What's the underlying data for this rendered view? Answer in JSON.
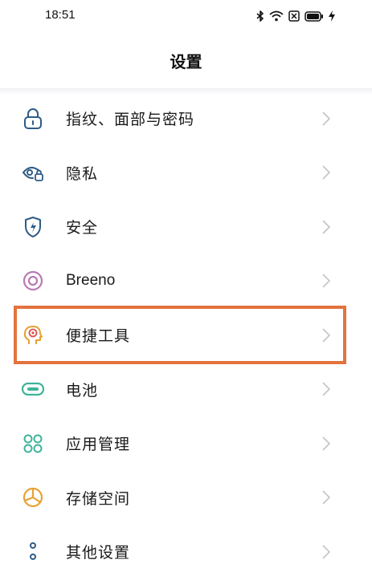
{
  "status": {
    "time": "18:51",
    "icons": [
      "bluetooth-icon",
      "wifi-icon",
      "sim-blocked-icon",
      "battery-icon",
      "charging-icon"
    ]
  },
  "header": {
    "title": "设置"
  },
  "colors": {
    "accent_highlight": "#e2733e",
    "icon_blue": "#2f5b86",
    "icon_purple": "#b87ab3",
    "icon_yellow": "#e6a234",
    "icon_green": "#3fb39b",
    "chevron": "#c4c4c4"
  },
  "settings": {
    "items": [
      {
        "label": "指纹、面部与密码",
        "icon": "lock-icon"
      },
      {
        "label": "隐私",
        "icon": "privacy-eye-lock-icon"
      },
      {
        "label": "安全",
        "icon": "shield-bolt-icon"
      },
      {
        "label": "Breeno",
        "icon": "breeno-ring-icon"
      },
      {
        "label": "便捷工具",
        "icon": "head-target-icon",
        "highlighted": true
      },
      {
        "label": "电池",
        "icon": "battery-capsule-icon"
      },
      {
        "label": "应用管理",
        "icon": "app-grid-icon"
      },
      {
        "label": "存储空间",
        "icon": "pie-storage-icon"
      },
      {
        "label": "其他设置",
        "icon": "dots-icon"
      }
    ]
  }
}
